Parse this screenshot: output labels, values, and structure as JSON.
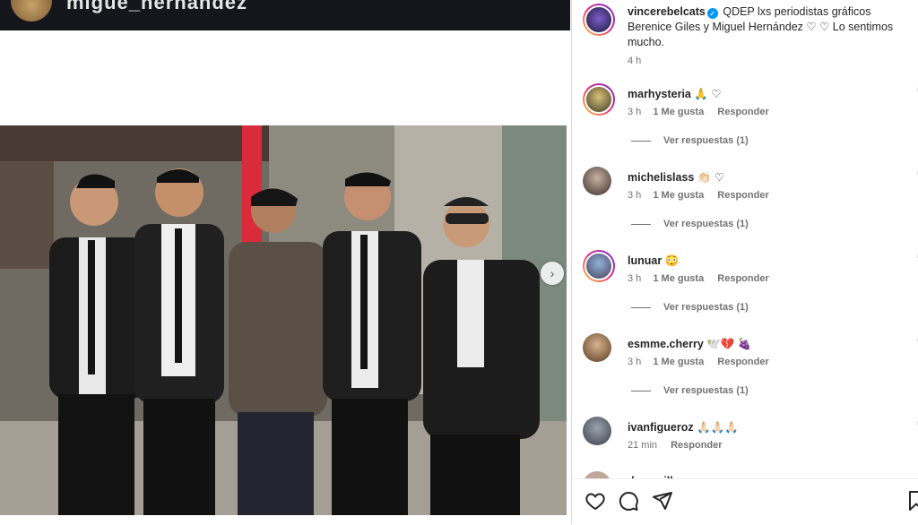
{
  "post_header": {
    "username": "migue_hernandez"
  },
  "caption": {
    "username": "vincerebelcats",
    "text": "QDEP lxs periodistas gráficos Berenice Giles y Miguel Hernández ♡ ♡ Lo sentimos mucho.",
    "time": "4 h"
  },
  "comments": [
    {
      "username": "marhysteria",
      "text": "🙏 ♡",
      "time": "3 h",
      "likes": "1 Me gusta",
      "reply": "Responder",
      "replies": "Ver respuestas (1)"
    },
    {
      "username": "michelislass",
      "text": "👏🏻 ♡",
      "time": "3 h",
      "likes": "1 Me gusta",
      "reply": "Responder",
      "replies": "Ver respuestas (1)"
    },
    {
      "username": "lunuar",
      "text": "😳",
      "time": "3 h",
      "likes": "1 Me gusta",
      "reply": "Responder",
      "replies": "Ver respuestas (1)"
    },
    {
      "username": "esmme.cherry",
      "text": "🕊️💔 🍇",
      "time": "3 h",
      "likes": "1 Me gusta",
      "reply": "Responder",
      "replies": "Ver respuestas (1)"
    },
    {
      "username": "ivanfigueroz",
      "text": "🙏🏻🙏🏻🙏🏻",
      "time": "21 min",
      "likes": "",
      "reply": "Responder",
      "replies": ""
    }
  ],
  "partial_comment": {
    "username": "danamille"
  },
  "colors": {
    "accent": "#0095f6",
    "ring_start": "#f9ce34",
    "ring_mid": "#ee2a7b",
    "ring_end": "#6228d7"
  }
}
